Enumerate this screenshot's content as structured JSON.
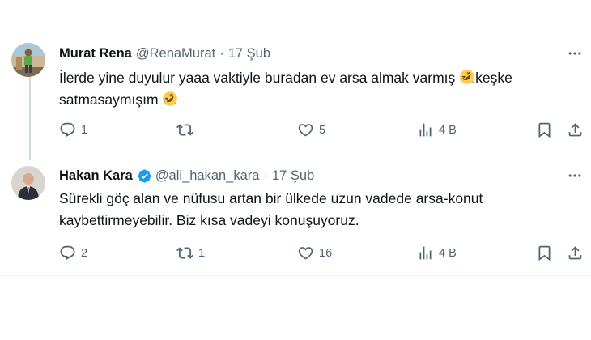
{
  "tweets": [
    {
      "name": "Murat Rena",
      "handle": "@RenaMurat",
      "separator": "·",
      "date": "17 Şub",
      "text_line1_a": "İlerde yine duyulur yaaa vaktiyle buradan ev arsa almak varmış ",
      "text_line1_b": "keşke",
      "text_line2": "satmasaymışım ",
      "emoji": "rolling-on-floor-laughing-emoji",
      "replies": "1",
      "retweets": "",
      "likes": "5",
      "views": "4 B"
    },
    {
      "name": "Hakan Kara",
      "handle": "@ali_hakan_kara",
      "separator": "·",
      "date": "17 Şub",
      "verified": true,
      "text_line1": "Sürekli göç alan ve nüfusu artan bir ülkede uzun vadede arsa-konut",
      "text_line2": "kaybettirmeyebilir. Biz kısa vadeyi konuşuyoruz.",
      "replies": "2",
      "retweets": "1",
      "likes": "16",
      "views": "4 B"
    }
  ],
  "colors": {
    "text": "#0f1419",
    "muted": "#536471",
    "verified": "#1d9bf0",
    "line": "#cfd9de"
  },
  "icons": [
    "reply-icon",
    "retweet-icon",
    "like-icon",
    "views-icon",
    "bookmark-icon",
    "share-icon",
    "more-icon",
    "verified-badge-icon"
  ]
}
